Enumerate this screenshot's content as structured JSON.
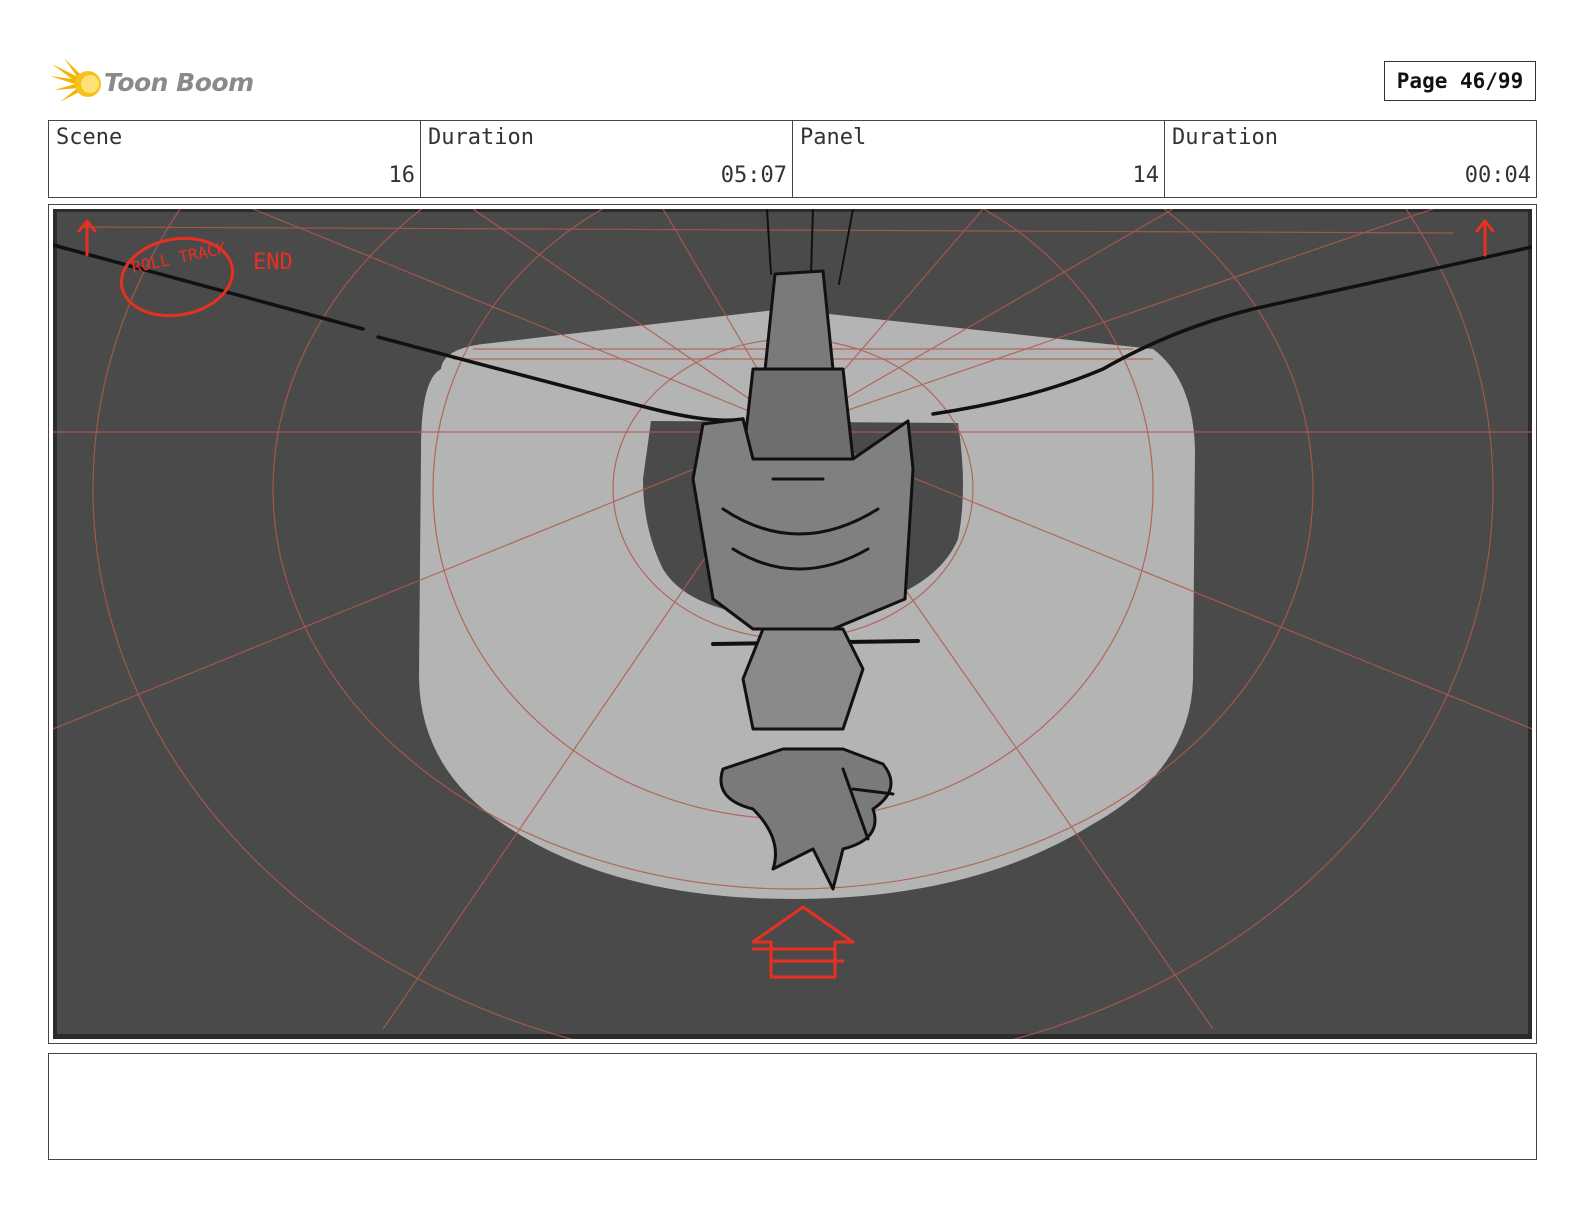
{
  "header": {
    "logo_text": "Toon Boom",
    "page_label": "Page 46/99"
  },
  "info": {
    "scene_label": "Scene",
    "scene_value": "16",
    "scene_duration_label": "Duration",
    "scene_duration_value": "05:07",
    "panel_label": "Panel",
    "panel_value": "14",
    "panel_duration_label": "Duration",
    "panel_duration_value": "00:04"
  },
  "panel": {
    "annotation_circle": "ROLL TRACK",
    "annotation_end": "END",
    "colors": {
      "background": "#4a4a4a",
      "light_area": "#b4b4b4",
      "guides": "#b05a4a",
      "annotation": "#e83020"
    }
  },
  "notes": {
    "text": ""
  }
}
